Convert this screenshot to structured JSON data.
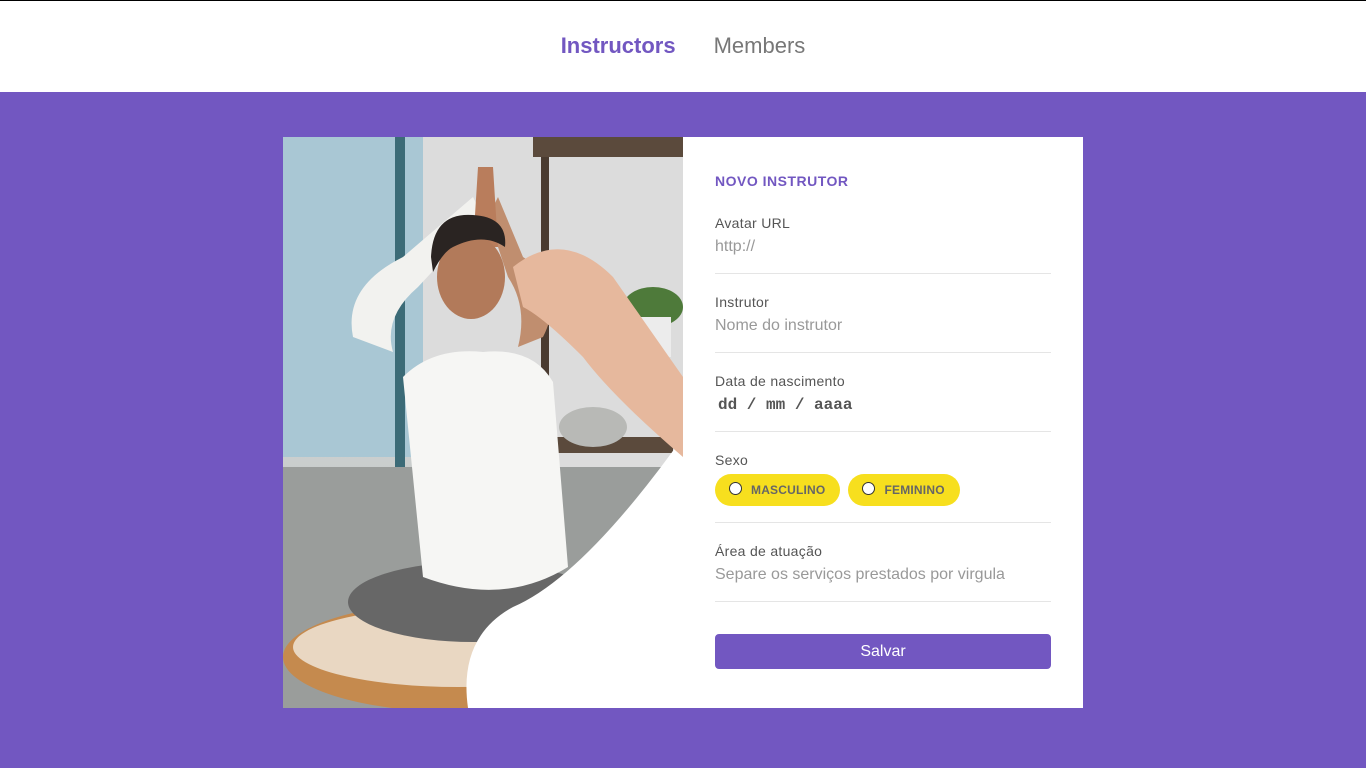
{
  "nav": {
    "items": [
      {
        "label": "Instructors",
        "active": true
      },
      {
        "label": "Members",
        "active": false
      }
    ]
  },
  "colors": {
    "primary": "#7257c1",
    "accent": "#f7df1e",
    "background": "#7257c1"
  },
  "hero_image": {
    "icon": "yoga-photo"
  },
  "form": {
    "title": "NOVO INSTRUTOR",
    "avatar": {
      "label": "Avatar URL",
      "placeholder": "http://",
      "value": ""
    },
    "instructor": {
      "label": "Instrutor",
      "placeholder": "Nome do instrutor",
      "value": ""
    },
    "birth": {
      "label": "Data de nascimento",
      "placeholder": "dd / mm / aaaa"
    },
    "gender": {
      "label": "Sexo",
      "options": [
        "MASCULINO",
        "FEMININO"
      ]
    },
    "services": {
      "label": "Área de atuação",
      "placeholder": "Separe os serviços prestados por virgula",
      "value": ""
    },
    "submit_label": "Salvar"
  }
}
